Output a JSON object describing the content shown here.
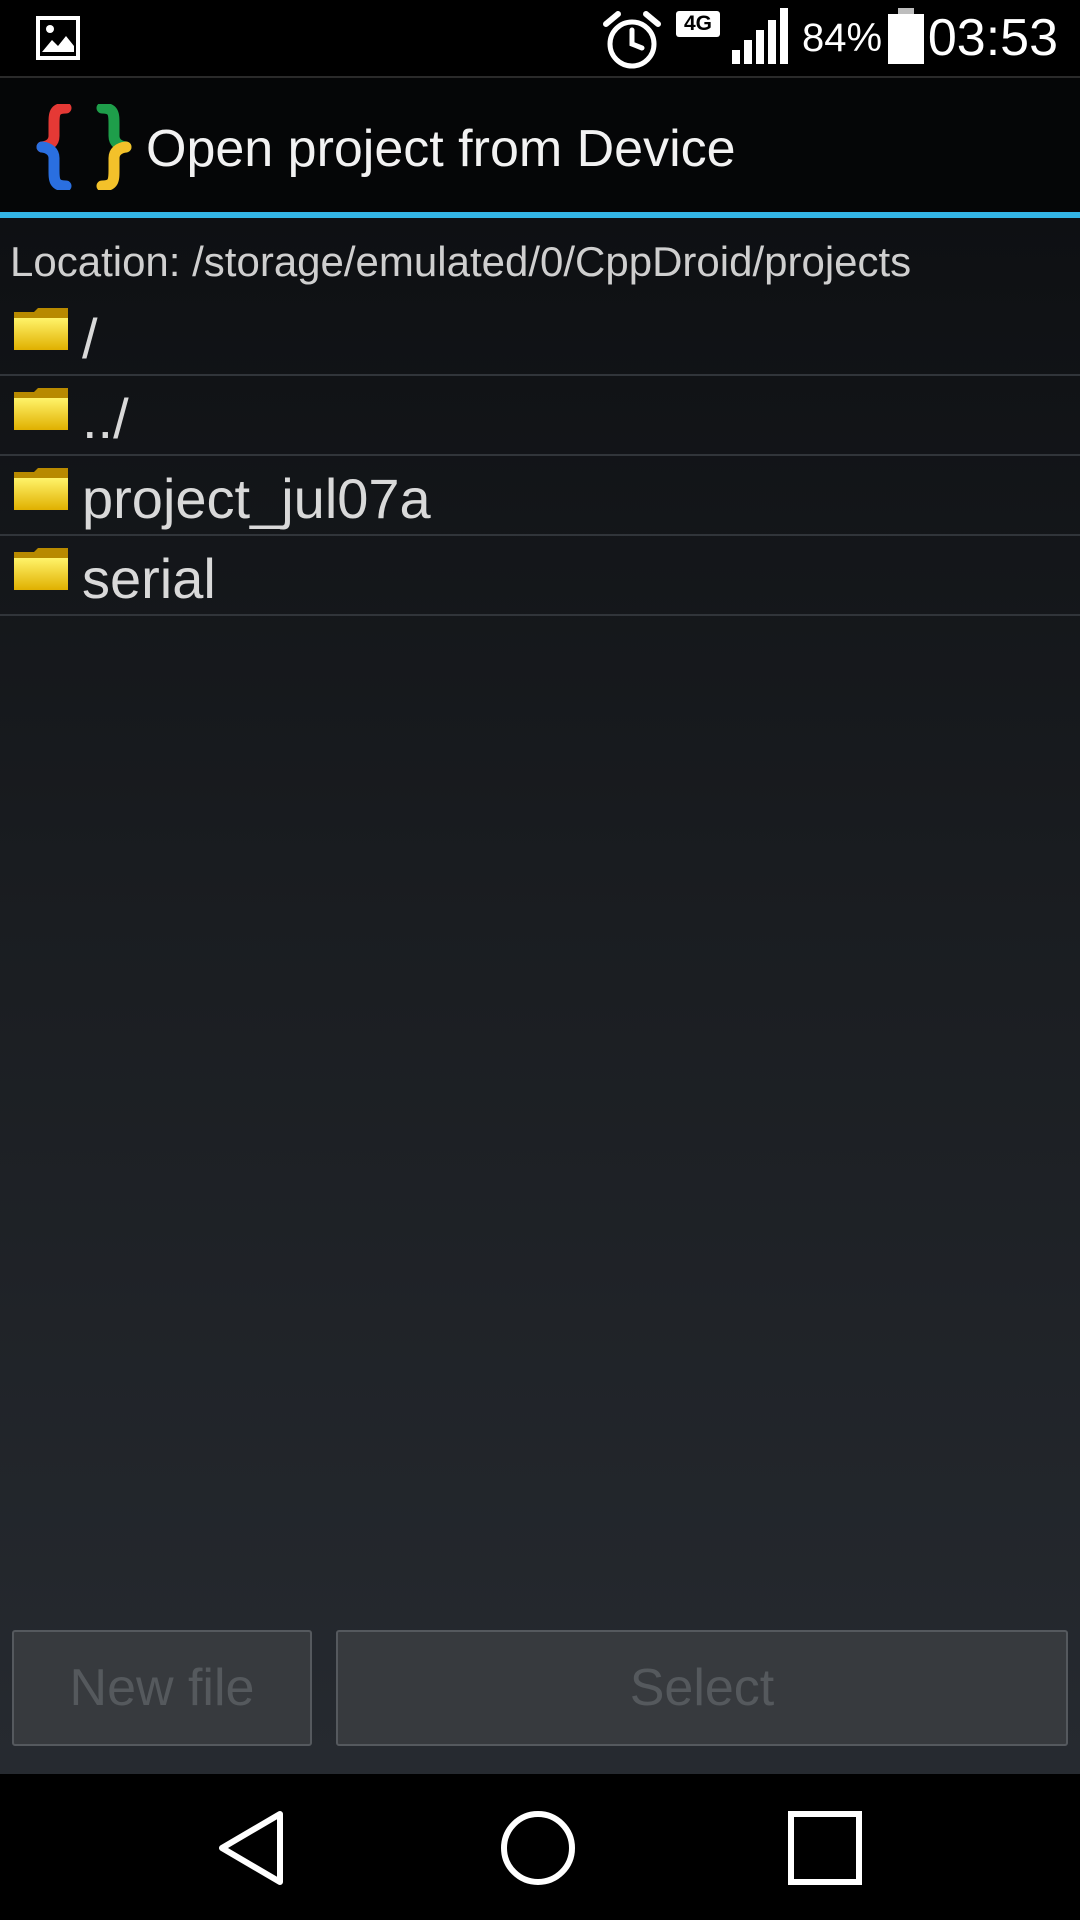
{
  "status_bar": {
    "network": "4G",
    "battery_percent": "84%",
    "time": "03:53",
    "icons": [
      "gallery-icon",
      "alarm-icon",
      "signal-icon",
      "battery-icon"
    ]
  },
  "header": {
    "title": "Open project from Device",
    "logo": "braces-logo-icon",
    "accent_color": "#33b5e5"
  },
  "location": {
    "text": "Location: /storage/emulated/0/CppDroid/projects"
  },
  "files": [
    {
      "name": "/",
      "icon": "folder-icon"
    },
    {
      "name": "../",
      "icon": "folder-icon"
    },
    {
      "name": "project_jul07a",
      "icon": "folder-icon"
    },
    {
      "name": "serial",
      "icon": "folder-icon"
    }
  ],
  "buttons": {
    "new_file": "New file",
    "select": "Select"
  },
  "nav_bar": {
    "items": [
      "back-icon",
      "home-icon",
      "recents-icon"
    ]
  }
}
